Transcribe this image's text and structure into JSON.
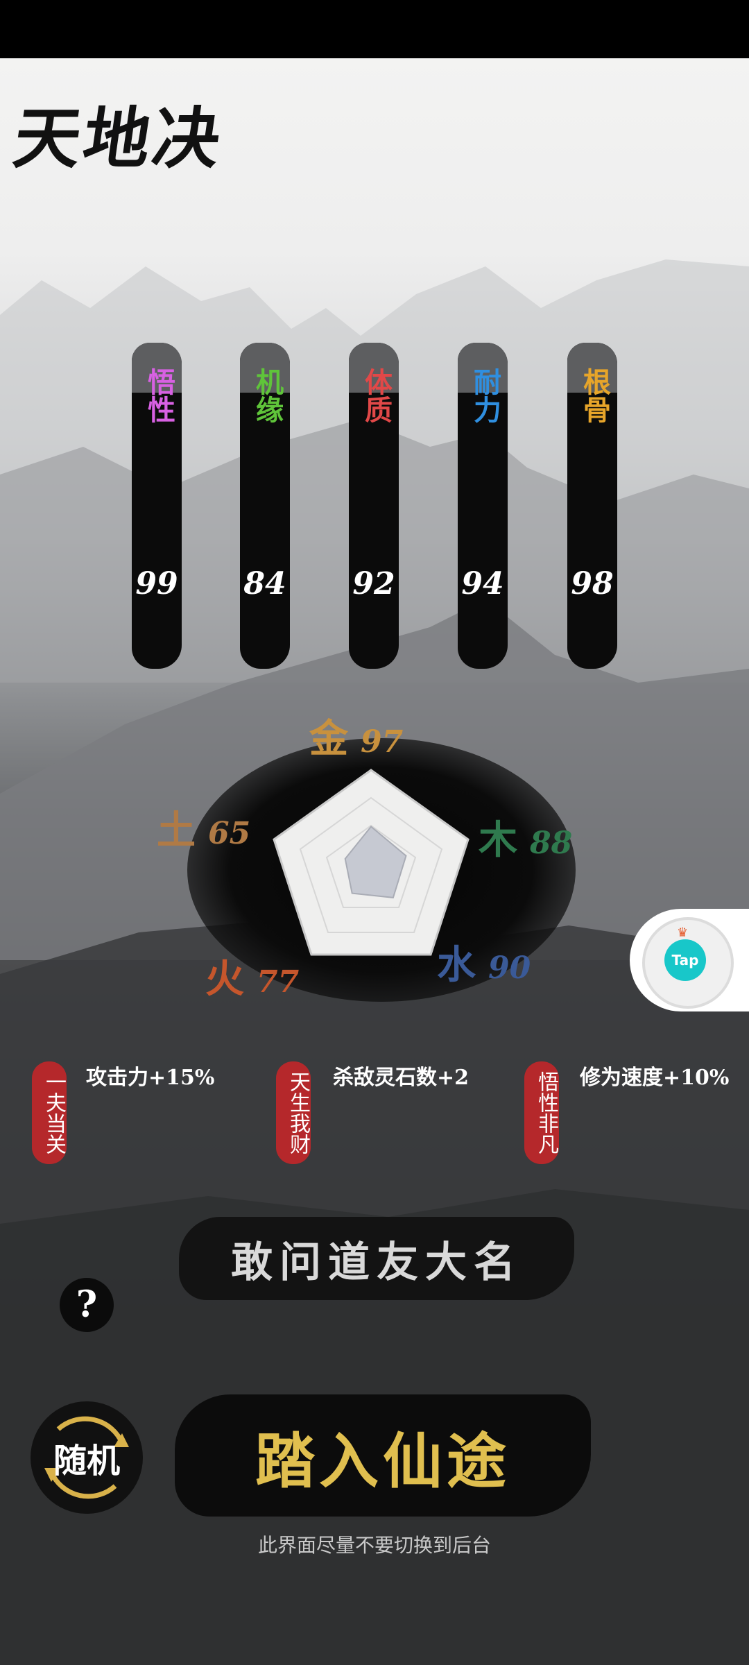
{
  "app": {
    "title": "天地决"
  },
  "stats": [
    {
      "label": "悟性",
      "value": "99",
      "color": "#d861e3"
    },
    {
      "label": "机缘",
      "value": "84",
      "color": "#5fc43a"
    },
    {
      "label": "体质",
      "value": "92",
      "color": "#e14848"
    },
    {
      "label": "耐力",
      "value": "94",
      "color": "#2f8fe0"
    },
    {
      "label": "根骨",
      "value": "98",
      "color": "#e7a52a"
    }
  ],
  "elements": {
    "metal": {
      "name": "金",
      "value": "97",
      "color": "#c8913e"
    },
    "wood": {
      "name": "木",
      "value": "88",
      "color": "#2f7a4e"
    },
    "water": {
      "name": "水",
      "value": "90",
      "color": "#3a5a98"
    },
    "fire": {
      "name": "火",
      "value": "77",
      "color": "#c5562c"
    },
    "earth": {
      "name": "土",
      "value": "65",
      "color": "#b07a45"
    }
  },
  "traits": [
    {
      "name": "一夫当关",
      "effect": "攻击力+15%"
    },
    {
      "name": "天生我财",
      "effect": "杀敌灵石数+2"
    },
    {
      "name": "悟性非凡",
      "effect": "修为速度+10%"
    }
  ],
  "name_prompt": "敢问道友大名",
  "help_label": "?",
  "random_label": "随机",
  "enter_label": "踏入仙途",
  "hint": "此界面尽量不要切换到后台",
  "floating_badge": {
    "label": "Tap",
    "icon": "taptap-icon"
  },
  "colors": {
    "accent_gold": "#e0bf4f",
    "trait_red": "#b5282b"
  }
}
